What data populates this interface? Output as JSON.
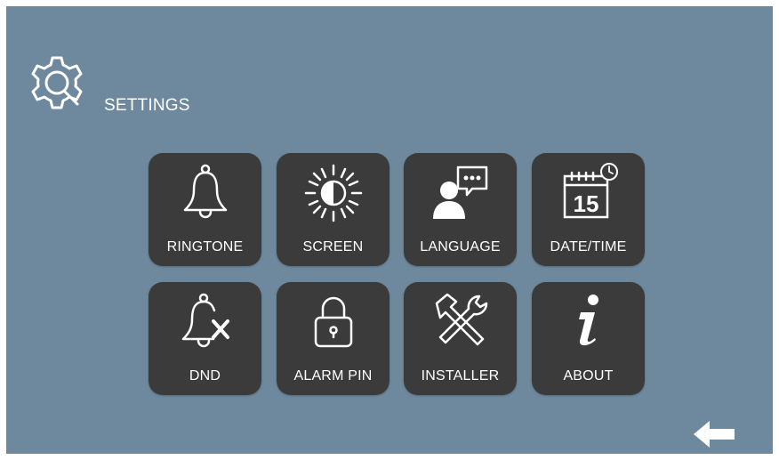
{
  "header": {
    "title": "SETTINGS",
    "icon": "settings-gear-icon"
  },
  "tiles": [
    {
      "label": "RINGTONE",
      "icon": "bell-icon"
    },
    {
      "label": "SCREEN",
      "icon": "brightness-icon"
    },
    {
      "label": "LANGUAGE",
      "icon": "user-speech-icon"
    },
    {
      "label": "DATE/TIME",
      "icon": "calendar-clock-icon",
      "calendar_day": "15"
    },
    {
      "label": "DND",
      "icon": "bell-muted-icon"
    },
    {
      "label": "ALARM PIN",
      "icon": "padlock-icon"
    },
    {
      "label": "INSTALLER",
      "icon": "tools-icon"
    },
    {
      "label": "ABOUT",
      "icon": "info-icon"
    }
  ],
  "navigation": {
    "back_icon": "back-arrow-icon"
  },
  "colors": {
    "background": "#6e899e",
    "tile": "#3b3b3c",
    "text": "#ffffff"
  }
}
